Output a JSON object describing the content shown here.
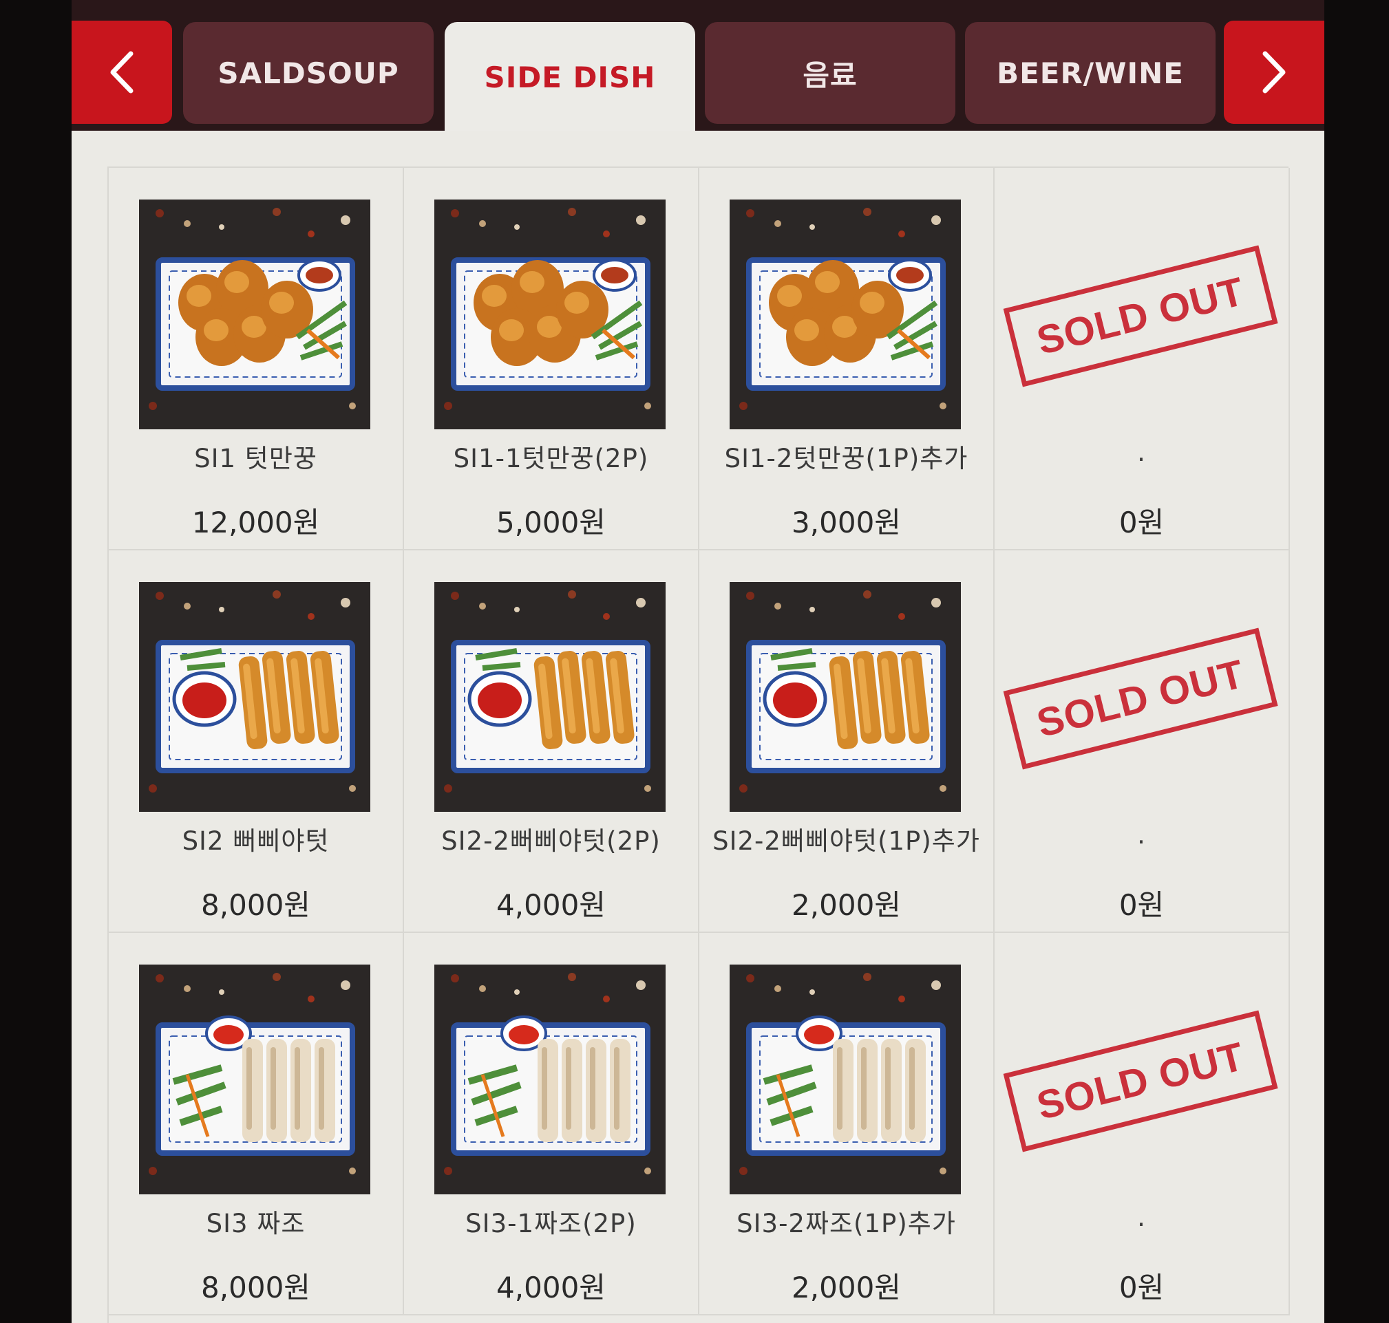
{
  "tabs": {
    "prev_icon": "chevron-left-icon",
    "next_icon": "chevron-right-icon",
    "items": [
      {
        "label": "SALDSOUP",
        "active": false
      },
      {
        "label": "SIDE DISH",
        "active": true
      },
      {
        "label": "음료",
        "active": false
      },
      {
        "label": "BEER/WINE",
        "active": false
      }
    ]
  },
  "menu": {
    "rows": [
      [
        {
          "name": "SI1 텃만꿍",
          "price": "12,000원",
          "image": "fishcake"
        },
        {
          "name": "SI1-1텃만꿍(2P)",
          "price": "5,000원",
          "image": "fishcake"
        },
        {
          "name": "SI1-2텃만꿍(1P)추가",
          "price": "3,000원",
          "image": "fishcake"
        },
        {
          "name": ".",
          "price": "0원",
          "sold_out": "SOLD OUT"
        }
      ],
      [
        {
          "name": "SI2 뻐삐야텃",
          "price": "8,000원",
          "image": "springroll-fried"
        },
        {
          "name": "SI2-2뻐삐야텃(2P)",
          "price": "4,000원",
          "image": "springroll-fried"
        },
        {
          "name": "SI2-2뻐삐야텃(1P)추가",
          "price": "2,000원",
          "image": "springroll-fried"
        },
        {
          "name": ".",
          "price": "0원",
          "sold_out": "SOLD OUT"
        }
      ],
      [
        {
          "name": "SI3 짜조",
          "price": "8,000원",
          "image": "springroll-fresh"
        },
        {
          "name": "SI3-1짜조(2P)",
          "price": "4,000원",
          "image": "springroll-fresh"
        },
        {
          "name": "SI3-2짜조(1P)추가",
          "price": "2,000원",
          "image": "springroll-fresh"
        },
        {
          "name": ".",
          "price": "0원",
          "sold_out": "SOLD OUT"
        }
      ]
    ]
  },
  "colors": {
    "accent": "#c8151d",
    "tab_bg": "#5a2a30",
    "content_bg": "#ebeae5",
    "soldout": "#c8212d"
  }
}
